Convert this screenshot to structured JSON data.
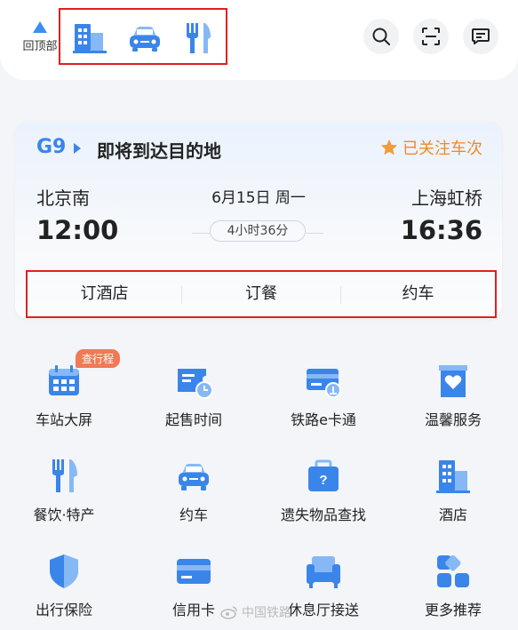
{
  "header": {
    "back_to_top_label": "回顶部",
    "quick_actions": [
      {
        "icon": "hotel-icon"
      },
      {
        "icon": "car-icon"
      },
      {
        "icon": "fork-knife-icon"
      }
    ],
    "actions": [
      {
        "icon": "search-icon"
      },
      {
        "icon": "scan-icon"
      },
      {
        "icon": "message-icon"
      }
    ]
  },
  "trip": {
    "train_no": "G9",
    "status": "即将到达目的地",
    "follow_label": "已关注车次",
    "depart_station": "北京南",
    "arrive_station": "上海虹桥",
    "date": "6月15日 周一",
    "depart_time": "12:00",
    "arrive_time": "16:36",
    "duration": "4小时36分"
  },
  "services": [
    "订酒店",
    "订餐",
    "约车"
  ],
  "grid": [
    {
      "label": "车站大屏",
      "icon": "station-screen-icon",
      "badge": "查行程"
    },
    {
      "label": "起售时间",
      "icon": "ticket-clock-icon"
    },
    {
      "label": "铁路e卡通",
      "icon": "rail-card-icon"
    },
    {
      "label": "温馨服务",
      "icon": "heart-service-icon"
    },
    {
      "label": "餐饮·特产",
      "icon": "dining-icon"
    },
    {
      "label": "约车",
      "icon": "car-icon"
    },
    {
      "label": "遗失物品查找",
      "icon": "lost-found-icon"
    },
    {
      "label": "酒店",
      "icon": "hotel-icon"
    },
    {
      "label": "出行保险",
      "icon": "insurance-icon"
    },
    {
      "label": "信用卡",
      "icon": "credit-card-icon"
    },
    {
      "label": "休息厅接送",
      "icon": "lounge-icon"
    },
    {
      "label": "更多推荐",
      "icon": "more-icon"
    }
  ],
  "watermark": "中国铁路",
  "colors": {
    "accent": "#3a85ea",
    "highlight_box": "#e02020",
    "follow": "#ee8a2a",
    "badge": "#ef7a55"
  }
}
